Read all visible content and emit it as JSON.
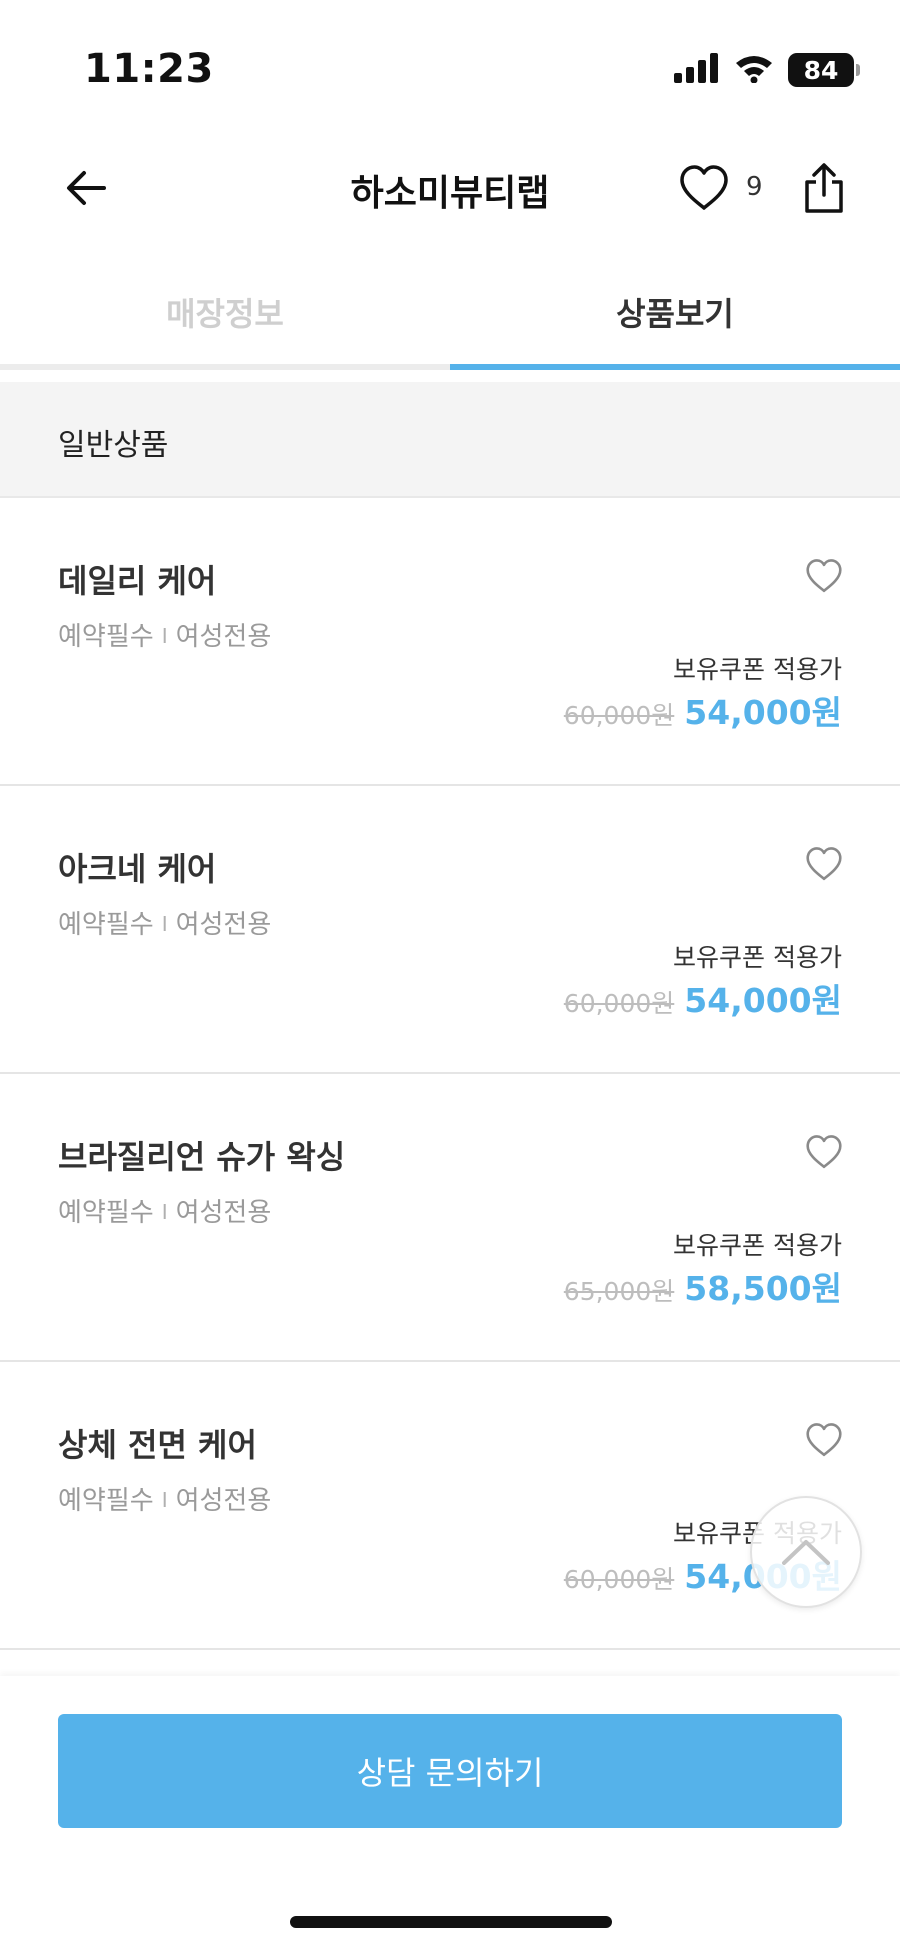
{
  "status_bar": {
    "time": "11:23",
    "battery": "84",
    "icons": [
      "signal-icon",
      "wifi-icon",
      "battery-icon"
    ]
  },
  "nav": {
    "title": "하소미뷰티랩",
    "like_count": "9",
    "icons": [
      "back-arrow-icon",
      "heart-icon",
      "share-icon"
    ]
  },
  "tabs": [
    {
      "label": "매장정보",
      "active": false
    },
    {
      "label": "상품보기",
      "active": true
    }
  ],
  "section": {
    "title": "일반상품"
  },
  "products": [
    {
      "name": "데일리 케어",
      "tag1": "예약필수",
      "tag_sep": "I",
      "tag2": "여성전용",
      "coupon_label": "보유쿠폰 적용가",
      "original_price": "60,000원",
      "sale_price": "54,000원"
    },
    {
      "name": "아크네 케어",
      "tag1": "예약필수",
      "tag_sep": "I",
      "tag2": "여성전용",
      "coupon_label": "보유쿠폰 적용가",
      "original_price": "60,000원",
      "sale_price": "54,000원"
    },
    {
      "name": "브라질리언 슈가 왁싱",
      "tag1": "예약필수",
      "tag_sep": "I",
      "tag2": "여성전용",
      "coupon_label": "보유쿠폰 적용가",
      "original_price": "65,000원",
      "sale_price": "58,500원"
    },
    {
      "name": "상체 전면 케어",
      "tag1": "예약필수",
      "tag_sep": "I",
      "tag2": "여성전용",
      "coupon_label": "보유쿠폰 적용가",
      "original_price": "60,000원",
      "sale_price": "54,000원"
    }
  ],
  "cta": {
    "label": "상담 문의하기"
  },
  "colors": {
    "accent": "#55b2ea",
    "inactive_tab": "#cfcfcf",
    "muted_text": "#9a9a9a",
    "section_bg": "#f4f4f4"
  }
}
